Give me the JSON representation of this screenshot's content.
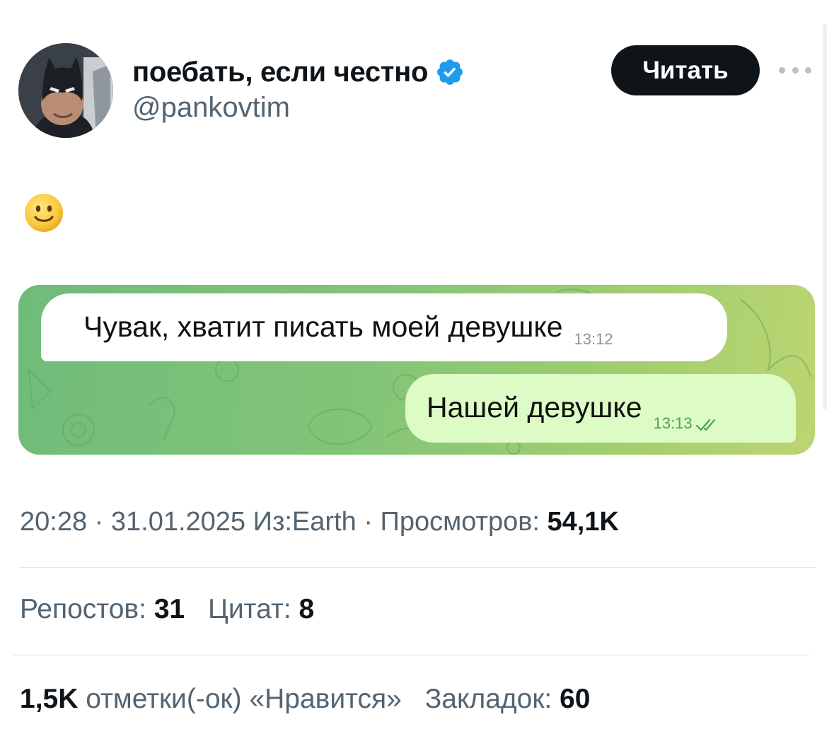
{
  "author": {
    "display_name": "поебать, если честно",
    "handle": "@pankovtim",
    "verified_icon": "verified-badge-icon",
    "accent_color": "#1d9bf0"
  },
  "header": {
    "follow_label": "Читать",
    "more_icon": "more-dots-icon"
  },
  "post": {
    "emoji": "slightly-smiling-face"
  },
  "chat_screenshot": {
    "incoming": {
      "text": "Чувак, хватит писать моей девушке",
      "time": "13:12"
    },
    "outgoing": {
      "text": "Нашей девушке",
      "time": "13:13",
      "status_icon": "double-check-icon"
    }
  },
  "meta": {
    "time": "20:28",
    "sep1": "·",
    "date": "31.01.2025",
    "location": "Из:Earth",
    "sep2": "·",
    "views_label": "Просмотров:",
    "views_value": "54,1K"
  },
  "stats": {
    "reposts_label": "Репостов:",
    "reposts_value": "31",
    "quotes_label": "Цитат:",
    "quotes_value": "8",
    "likes_value": "1,5K",
    "likes_label": "отметки(-ок) «Нравится»",
    "bookmarks_label": "Закладок:",
    "bookmarks_value": "60"
  }
}
